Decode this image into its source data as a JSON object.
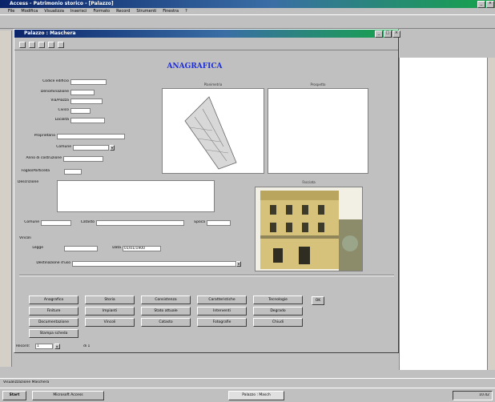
{
  "app": {
    "title": "Access - Patrimonio storico - [Palazzo]",
    "menu": [
      "File",
      "Modifica",
      "Visualizza",
      "Inserisci",
      "Formato",
      "Record",
      "Strumenti",
      "Finestra",
      "?"
    ]
  },
  "form": {
    "title": "Palazzo : Maschera",
    "heading": "ANAGRAFICA",
    "fields": [
      {
        "label": "Codice edificio",
        "value": ""
      },
      {
        "label": "Denominazione",
        "value": ""
      },
      {
        "label": "Via/Piazza",
        "value": ""
      },
      {
        "label": "Civico",
        "value": ""
      },
      {
        "label": "Località",
        "value": ""
      },
      {
        "label": "Proprietario",
        "value": ""
      },
      {
        "label": "Comune",
        "value": ""
      },
      {
        "label": "Anno di costruzione",
        "value": ""
      },
      {
        "label": "Foglio/Particella",
        "value": ""
      }
    ],
    "notes_label": "Descrizione",
    "row_fields": [
      {
        "label": "Comune",
        "value": ""
      },
      {
        "label": "Catasto",
        "value": ""
      },
      {
        "label": "Epoca",
        "value": ""
      }
    ],
    "section2_label": "Vincoli",
    "row2": [
      {
        "label": "Legge",
        "value": ""
      },
      {
        "label": "Data",
        "value": "01/01/1900"
      }
    ],
    "last_label": "Destinazione d'uso",
    "images": {
      "map_caption": "Planimetria",
      "blank_caption": "Prospetto",
      "facade_caption": "Facciata"
    },
    "buttons": [
      [
        "Anagrafica",
        "Storia",
        "Consistenza",
        "Caratteristiche",
        "Tecnologie"
      ],
      [
        "Finiture",
        "Impianti",
        "Stato attuale",
        "Interventi",
        "Degrado"
      ],
      [
        "Documentazione",
        "Vincoli",
        "Catasto",
        "Fotografie",
        "Chiudi"
      ],
      [
        "Stampa scheda"
      ]
    ],
    "side_button": "OK",
    "record_nav": {
      "label": "Record:",
      "value": "1",
      "total": "di 1"
    }
  },
  "statusbar": {
    "text": "Visualizzazione Maschera"
  },
  "taskbar": {
    "start": "Start",
    "tasks": [
      "Microsoft Access",
      "Palazzo : Masch"
    ],
    "clock": "10.42"
  },
  "colors": {
    "accent": "#0a246a",
    "gradient_end": "#16a34a"
  }
}
